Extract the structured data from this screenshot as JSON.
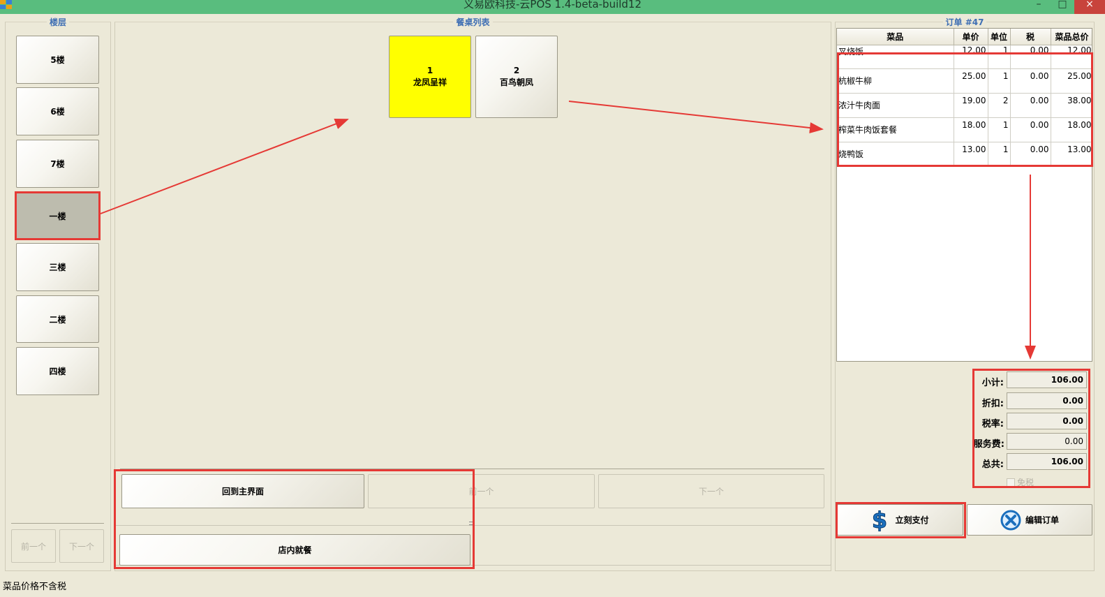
{
  "window": {
    "title": "义易欧科技-云POS 1.4-beta-build12",
    "minimize": "–",
    "maximize": "□",
    "close": "×"
  },
  "floors": {
    "title": "楼层",
    "items": [
      {
        "label": "5楼"
      },
      {
        "label": "6楼"
      },
      {
        "label": "7楼"
      },
      {
        "label": "一楼"
      },
      {
        "label": "三楼"
      },
      {
        "label": "二楼"
      },
      {
        "label": "四楼"
      }
    ],
    "selected": "一楼",
    "prev_label": "前一个",
    "next_label": "下一个"
  },
  "tables": {
    "title": "餐桌列表",
    "items": [
      {
        "number": "1",
        "name": "龙凤呈祥",
        "color": "#ffff00"
      },
      {
        "number": "2",
        "name": "百鸟朝凤"
      }
    ],
    "back_label": "回到主界面",
    "prev_label": "前一个",
    "next_label": "下一个",
    "dine_in_label": "店内就餐"
  },
  "order": {
    "title": "订单 #47",
    "columns": [
      "菜品",
      "单价",
      "单位",
      "税",
      "菜品总价"
    ],
    "rows": [
      {
        "name": "叉烧饭",
        "price": "12.00",
        "qty": "1",
        "tax": "0.00",
        "total": "12.00"
      },
      {
        "name": "杭椒牛柳",
        "price": "25.00",
        "qty": "1",
        "tax": "0.00",
        "total": "25.00"
      },
      {
        "name": "浓汁牛肉面",
        "price": "19.00",
        "qty": "2",
        "tax": "0.00",
        "total": "38.00"
      },
      {
        "name": "榨菜牛肉饭套餐",
        "price": "18.00",
        "qty": "1",
        "tax": "0.00",
        "total": "18.00"
      },
      {
        "name": "烧鸭饭",
        "price": "13.00",
        "qty": "1",
        "tax": "0.00",
        "total": "13.00"
      }
    ],
    "subtotal_label": "小计:",
    "subtotal": "106.00",
    "discount_label": "折扣:",
    "discount": "0.00",
    "tax_label": "税率:",
    "tax": "0.00",
    "service_label": "服务费:",
    "service": "0.00",
    "total_label": "总共:",
    "total": "106.00",
    "tax_free_label": "免税",
    "tax_free": false,
    "pay_label": "立刻支付",
    "edit_label": "编辑订单"
  },
  "status": {
    "text": "菜品价格不含税"
  },
  "colors": {
    "titlebar": "#59bd7e",
    "highlight": "#e53935",
    "group_title": "#3f6fb4",
    "selected_table": "#ffff00"
  }
}
